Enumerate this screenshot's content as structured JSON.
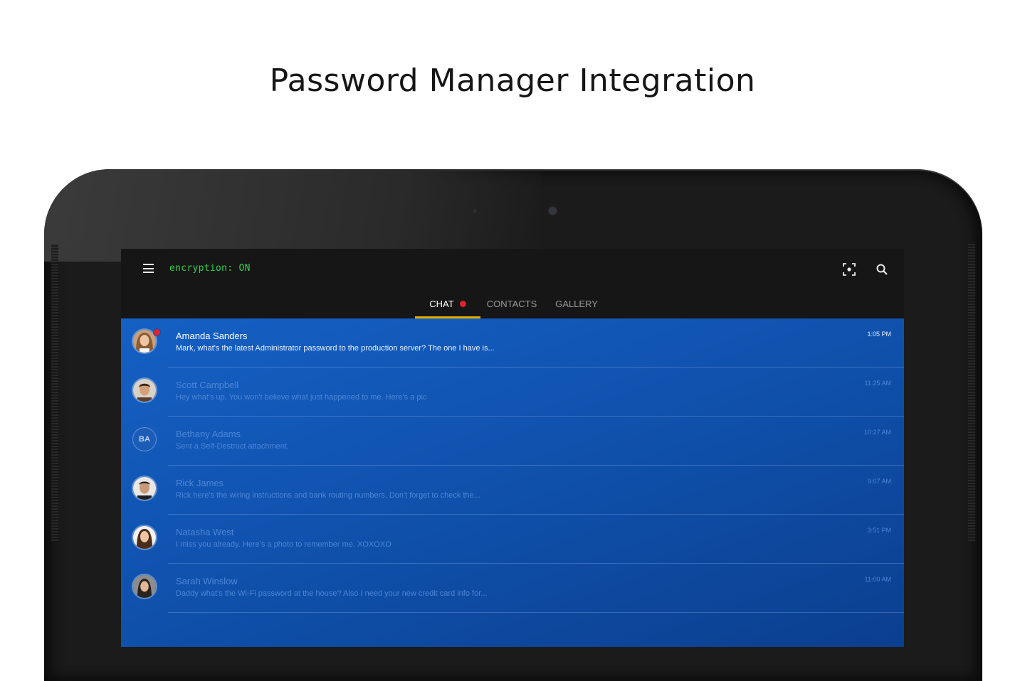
{
  "headline": "Password Manager Integration",
  "app": {
    "status_text": "encryption: ON",
    "icons": {
      "menu": "hamburger-menu-icon",
      "scan": "scan-icon",
      "search": "search-icon"
    },
    "tabs": [
      {
        "label": "CHAT",
        "active": true,
        "unread": true
      },
      {
        "label": "CONTACTS",
        "active": false
      },
      {
        "label": "GALLERY",
        "active": false
      }
    ],
    "conversations": [
      {
        "name": "Amanda Sanders",
        "preview": "Mark, what's the latest Administrator password to the production server? The one I have is...",
        "time": "1:05 PM",
        "unread": true,
        "avatar": "photo"
      },
      {
        "name": "Scott Campbell",
        "preview": "Hey what's up. You won't believe what just happened to me. Here's a pic",
        "time": "11:25 AM",
        "unread": false,
        "avatar": "photo"
      },
      {
        "name": "Bethany Adams",
        "preview": "Sent a Self-Destruct attachment.",
        "time": "10:27 AM",
        "unread": false,
        "avatar": "initials",
        "initials": "BA"
      },
      {
        "name": "Rick James",
        "preview": "Rick here's the wiring instructions and bank routing numbers. Don't forget to check the...",
        "time": "9:07 AM",
        "unread": false,
        "avatar": "photo"
      },
      {
        "name": "Natasha West",
        "preview": "I miss you already. Here's a photo to remember me. XOXOXO",
        "time": "3:51 PM",
        "unread": false,
        "avatar": "photo"
      },
      {
        "name": "Sarah Winslow",
        "preview": "Daddy what's the Wi-Fi password at the house? Also I need your new credit card info for...",
        "time": "11:00 AM",
        "unread": false,
        "avatar": "photo"
      }
    ]
  },
  "colors": {
    "accent_underline": "#e0b000",
    "status_green": "#32d04a",
    "unread_red": "#e4202e",
    "list_blue": "#1560c4"
  }
}
